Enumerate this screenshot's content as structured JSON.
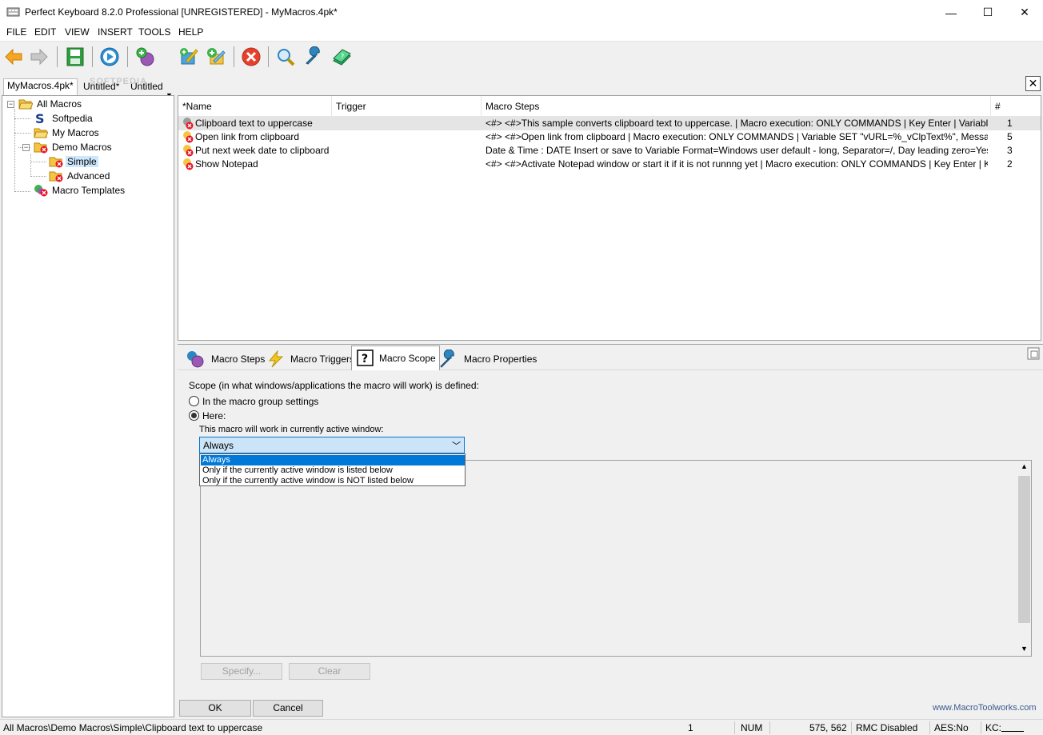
{
  "window": {
    "title": "Perfect Keyboard 8.2.0 Professional [UNREGISTERED] - MyMacros.4pk*",
    "minimize": "—",
    "maximize": "☐",
    "close": "✕"
  },
  "menu": [
    "FILE",
    "EDIT",
    "VIEW",
    "INSERT",
    "TOOLS",
    "HELP"
  ],
  "toolbar": {
    "icons": [
      "back-arrow-icon",
      "forward-arrow-icon",
      "save-icon",
      "run-icon",
      "add-macro-icon",
      "dropdown-arrow-icon",
      "edit-macro-icon",
      "add-group-icon",
      "delete-icon",
      "search-icon",
      "tools-wrench-icon",
      "help-book-icon"
    ]
  },
  "doc_tabs": [
    {
      "label": "MyMacros.4pk*",
      "active": true
    },
    {
      "label": "Untitled*",
      "active": false
    },
    {
      "label": "Untitled",
      "active": false
    }
  ],
  "watermark": "SOFTPEDIA",
  "tree": {
    "nodes": [
      {
        "label": "All Macros",
        "level": 0
      },
      {
        "label": "Softpedia",
        "level": 1
      },
      {
        "label": "My Macros",
        "level": 1
      },
      {
        "label": "Demo Macros",
        "level": 1
      },
      {
        "label": "Simple",
        "level": 2,
        "selected": true
      },
      {
        "label": "Advanced",
        "level": 2
      },
      {
        "label": "Macro Templates",
        "level": 1
      }
    ]
  },
  "list": {
    "columns": [
      "*Name",
      "Trigger",
      "Macro Steps",
      "#"
    ],
    "rows": [
      {
        "name": "Clipboard text to uppercase",
        "trigger": "",
        "steps": "<#> <#>This sample converts clipboard text to uppercase. | Macro execution: ONLY COMMANDS | Key Enter | Variable OPERATI...",
        "count": "1"
      },
      {
        "name": "Open link from clipboard",
        "trigger": "",
        "steps": "<#> <#>Open link from clipboard | Macro execution: ONLY COMMANDS | Variable SET \"vURL=%_vClpText%\", Message text=\"<n...",
        "count": "5"
      },
      {
        "name": "Put next week date to clipboard",
        "trigger": "",
        "steps": "Date & Time : DATE Insert or save to Variable Format=Windows user default - long, Separator=/, Day leading zero=Yes, Month lea...",
        "count": "3"
      },
      {
        "name": "Show Notepad",
        "trigger": "",
        "steps": "<#> <#>Activate Notepad window or start it if it is not runnng yet | Macro execution: ONLY COMMANDS | Key Enter | Key Enter | IF...",
        "count": "2"
      }
    ]
  },
  "panel_tabs": [
    {
      "label": "Macro Steps",
      "icon": "macro-steps-icon"
    },
    {
      "label": "Macro Triggers",
      "icon": "lightning-icon"
    },
    {
      "label": "Macro Scope",
      "icon": "question-icon",
      "active": true
    },
    {
      "label": "Macro Properties",
      "icon": "wrench-icon"
    }
  ],
  "scope": {
    "heading": "Scope (in what windows/applications the macro will work) is defined:",
    "option_group": "In the macro group settings",
    "option_here": "Here:",
    "selected_option": "Here:",
    "active_window_label": "This macro will work in currently active window:",
    "combo_value": "Always",
    "dropdown_options": [
      "Always",
      "Only if the currently active window is listed below",
      "Only if the currently active window is NOT listed below"
    ],
    "specify_label": "Specify...",
    "clear_label": "Clear"
  },
  "dialog": {
    "ok_label": "OK",
    "cancel_label": "Cancel",
    "website": "www.MacroToolworks.com"
  },
  "statusbar": {
    "path": "All Macros\\Demo Macros\\Simple\\Clipboard text to uppercase",
    "count": "1",
    "num": "NUM",
    "coords": "575, 562",
    "rmc": "RMC Disabled",
    "aes": "AES:No",
    "kc": "KC:"
  },
  "colors": {
    "accent": "#0078d7",
    "selection": "#cce8ff",
    "row_selected": "#e5e5e5",
    "error_red": "#e81123",
    "website_blue": "#3c5a8c"
  }
}
